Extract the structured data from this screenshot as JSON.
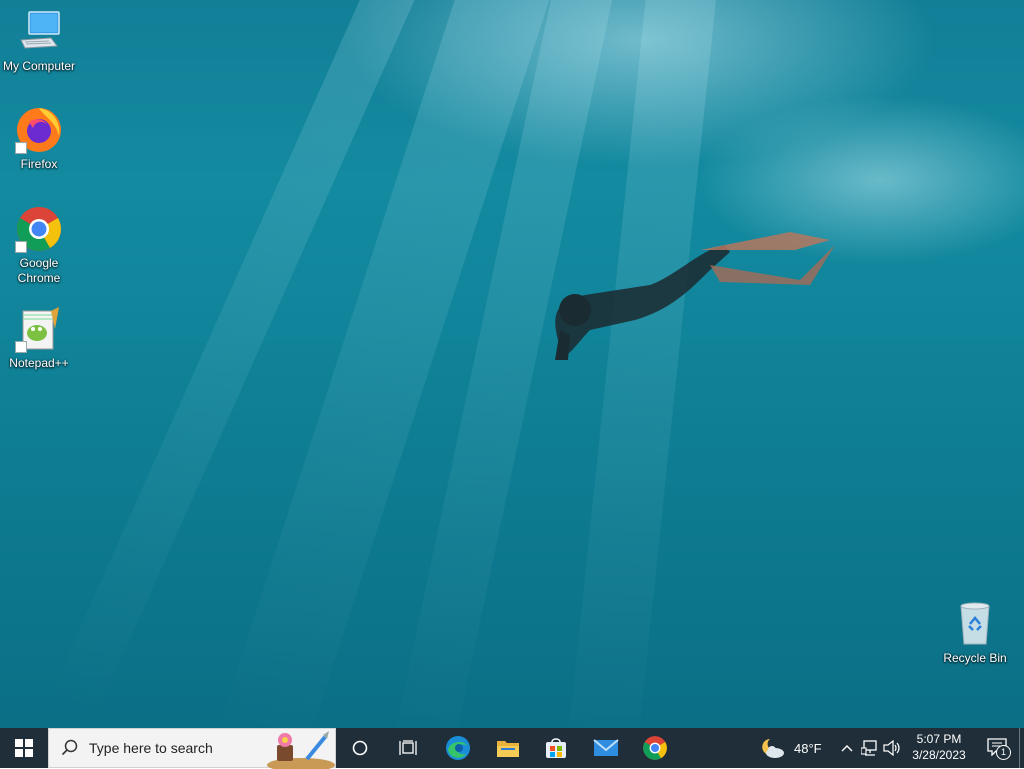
{
  "desktop": {
    "icons": [
      {
        "label": "My Computer",
        "icon": "computer-icon"
      },
      {
        "label": "Firefox",
        "icon": "firefox-icon"
      },
      {
        "label": "Google Chrome",
        "icon": "chrome-icon"
      },
      {
        "label": "Notepad++",
        "icon": "notepadpp-icon"
      },
      {
        "label": "Recycle Bin",
        "icon": "recycle-bin-icon"
      }
    ]
  },
  "taskbar": {
    "search_placeholder": "Type here to search",
    "pinned": [
      "start-icon",
      "cortana-icon",
      "task-view-icon",
      "edge-icon",
      "file-explorer-icon",
      "microsoft-store-icon",
      "mail-icon",
      "chrome-icon"
    ],
    "weather": {
      "temperature": "48°F",
      "icon": "partly-cloudy-night-icon"
    },
    "clock": {
      "time": "5:07 PM",
      "date": "3/28/2023"
    },
    "notifications": {
      "count": "1"
    }
  },
  "colors": {
    "taskbar": "#1f2e38",
    "search_box": "#f3f3f3",
    "water": "#138aa0"
  }
}
